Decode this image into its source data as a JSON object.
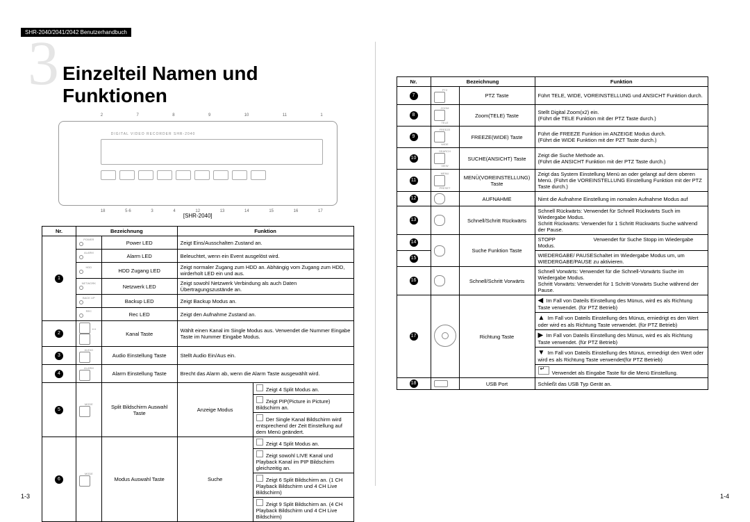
{
  "header": "SHR-2040/2041/2042 Benutzerhandbuch",
  "chapter": {
    "num": "3",
    "title": "Einzelteil Namen und Funktionen"
  },
  "diagram_label": "[SHR-2040]",
  "device_text": "DIGITAL VIDEO RECORDER   SHR-2040",
  "table_headers": {
    "nr": "Nr.",
    "name": "Bezeichnung",
    "func": "Funktion"
  },
  "left_rows": [
    {
      "nr": "1",
      "icon": "POWER",
      "name": "Power LED",
      "func": "Zeigt Eins/Ausschalten Zustand an."
    },
    {
      "icon": "ALARM",
      "name": "Alarm LED",
      "func": "Beleuchtet, wenn ein Event ausgelöst wird."
    },
    {
      "icon": "HDD",
      "name": "HDD Zugang LED",
      "func": "Zeigt normaler Zugang zum HDD an. Abhängig vom Zugang zum HDD, wirderholt LED ein und aus."
    },
    {
      "icon": "NETWORK",
      "name": "Netzwerk LED",
      "func": "Zeigt sowohl Netzwerk Verbindung als auch Daten Übertragungszustände an."
    },
    {
      "icon": "BACK UP",
      "name": "Backup LED",
      "func": "Zeigt Backup Modus an."
    },
    {
      "icon": "REC",
      "name": "Rec LED",
      "func": "Zeigt den Aufnahme Zustand an."
    },
    {
      "nr": "2",
      "icon": "1..4",
      "name": "Kanal Taste",
      "func": "Wählt einen Kanal im Single Modus aus. Verwendet die Nummer Eingabe Taste im Nummer Eingabe Modus."
    },
    {
      "nr": "3",
      "icon": "AUDIO",
      "name": "Audio Einstellung Taste",
      "func": "Stellt Audio Ein/Aus ein."
    },
    {
      "nr": "4",
      "icon": "ALARM",
      "name": "Alarm Einstellung Taste",
      "func": "Brecht das Alarm ab, wenn die Alarm Taste ausgewählt wird."
    }
  ],
  "left_mode5": {
    "nr": "5",
    "name": "Split Bildschirm Auswahl Taste",
    "sub": "Anzeige Modus",
    "r1": "Zeigt 4 Split Modus an.",
    "r2": "Zeigt PIP(Picture in Picture) Bildschirm an.",
    "r3": "Der Single Kanal Bildschirm wird entsprechend der Zeit Einstellung auf dem Menü geändert."
  },
  "left_mode6": {
    "nr": "6",
    "name": "Modus Auswahl Taste",
    "sub": "Suche",
    "r1": "Zeigt 4 Split Modus an.",
    "r2": "Zeigt sowohl LIVE Kanal und Playback Kanal im PIP Bildschirm gleichzeitig an.",
    "r3": "Zeigt 6 Split Bildschirm an. (1 CH Playback Bildschirm und 4 CH Live Bildschirm)",
    "r4": "Zeigt 9 Split Bildschirm an. (4 CH Playback Bildschirm und 4 CH Live Bildschirm)"
  },
  "right_rows": [
    {
      "nr": "7",
      "icon": "PTZ",
      "name": "PTZ Taste",
      "func": "Führt TELE, WIDE, VOREINSTELLUNG und ANSICHT Funktion durch."
    },
    {
      "nr": "8",
      "icon": "ZOOM/TELE",
      "name": "Zoom(TELE) Taste",
      "func": "Stellt Digital Zoom(x2) ein.\n(Führt die TELE Funktion mit der PTZ Taste durch.)"
    },
    {
      "nr": "9",
      "icon": "FREEZE/WIDE",
      "name": "FREEZE(WIDE) Taste",
      "func": "Führt die FREEZE Funktion im ANZEIGE Modus durch.\n(Führt die WIDE Funktion mit der PZT Taste durch.)"
    },
    {
      "nr": "10",
      "icon": "SEARCH/VIEW",
      "name": "SUCHE(ANSICHT) Taste",
      "func": "Zeigt die Suche Methode an.\n(Führt die ANSICHT Funktion mit der PTZ Taste durch.)"
    },
    {
      "nr": "11",
      "icon": "MENU/PRESET",
      "name": "MENÜ(VOREINSTELLUNG) Taste",
      "func": "Zeigt das System Einstellung Menü an oder gelangt auf dem oberen Menü. (Führt die VOREINSTELLUNG Einstellung Funktion mit der PTZ Taste durch.)"
    },
    {
      "nr": "12",
      "icon": "REC",
      "name": "AUFNAHME",
      "func": "Nimt die Aufnahme Einstellung im nomalen Aufnahme Modus auf"
    },
    {
      "nr": "13",
      "icon": "REW",
      "name": "Schnell/Schritt Rückwärts",
      "func": "Schnell Rückwärts: Verwendet für Schnell Rückwärts Such im Wiedergabe Modus.\nSchritt Rückwärts: Verwendet für 1 Schritt Rückwärts Suche während der Pause."
    },
    {
      "nr": "14",
      "icon": "STOP",
      "name": "Suche Funktion Taste",
      "sub": "STOPP",
      "func": "Verwendet für Suche Stopp im Wiedergabe Modus."
    },
    {
      "nr": "15",
      "icon": "PLAY",
      "sub": "WIEDERGABE/ PAUSE",
      "func": "Schaltet im Wiedergabe Modus um, um WIEDERGABE/PAUSE zu aktivieren."
    },
    {
      "nr": "16",
      "icon": "FF",
      "name": "Schnell/Schritt Vorwärts",
      "func": "Schnell Vorwärts: Verwendet für die Schnell-Vorwärts Suche im Wiedergabe Modus.\nSchritt Vorwärts: Verwendet für 1 Schritt-Vorwärts Suche während der Pause."
    }
  ],
  "dir": {
    "nr": "17",
    "name": "Richtung Taste",
    "left": "Im Fall von Dateils Einstellung des Münus, wird es als Richtung Taste verwendet. (für PTZ Betrieb)",
    "up": "Im Fall von Dateils Einstellung des Münus, erniedrigt es den Wert oder wird es als Richtung Taste verwendet. (für PTZ Betrieb)",
    "right": "Im Fall von Dateils Einstellung des Münus, wird es als Richtung Taste verwendet. (für PTZ Betrieb)",
    "down": "Im Fall von Dateils Einstellung des Münus, ermedrigt den Wert oder wird es als Richtung Taste verwendet(für PTZ Betrieb)",
    "enter": "Verwendet als Eingabe Taste für die Menü Einstellung."
  },
  "usb": {
    "nr": "18",
    "name": "USB Port",
    "func": "Schließt das USB Typ Gerät an."
  },
  "page_left": "1-3",
  "page_right": "1-4"
}
